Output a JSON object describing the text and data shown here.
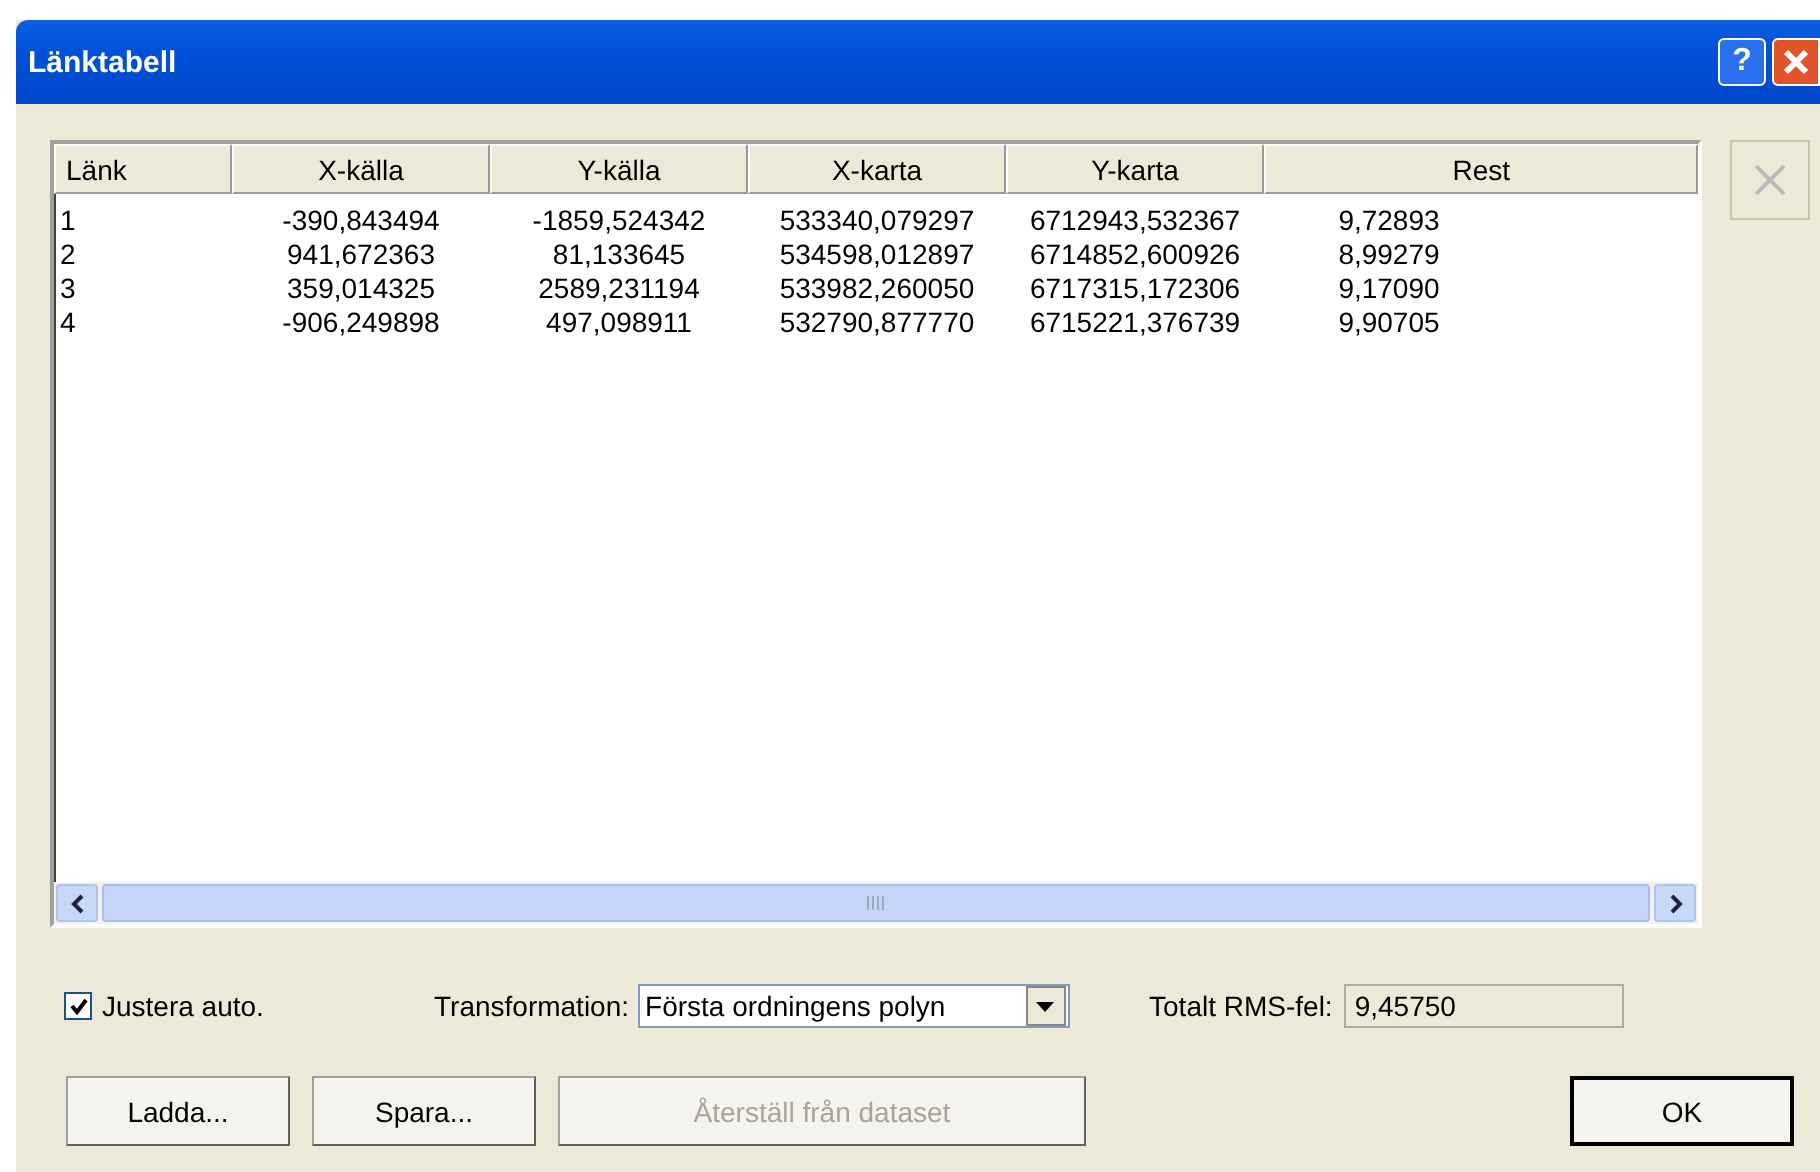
{
  "window": {
    "title": "Länktabell",
    "help_button": "?"
  },
  "table": {
    "columns": [
      "Länk",
      "X-källa",
      "Y-källa",
      "X-karta",
      "Y-karta",
      "Rest"
    ],
    "rows": [
      [
        "1",
        "-390,843494",
        "-1859,524342",
        "533340,079297",
        "6712943,532367",
        "9,72893"
      ],
      [
        "2",
        "941,672363",
        "81,133645",
        "534598,012897",
        "6714852,600926",
        "8,99279"
      ],
      [
        "3",
        "359,014325",
        "2589,231194",
        "533982,260050",
        "6717315,172306",
        "9,17090"
      ],
      [
        "4",
        "-906,249898",
        "497,098911",
        "532790,877770",
        "6715221,376739",
        "9,90705"
      ]
    ]
  },
  "delete_button": {
    "disabled": true
  },
  "auto_adjust": {
    "label": "Justera auto.",
    "checked": true
  },
  "transformation": {
    "label": "Transformation:",
    "value": "Första ordningens polyn"
  },
  "rms": {
    "label": "Totalt RMS-fel:",
    "value": "9,45750"
  },
  "buttons": [
    {
      "label": "Ladda...",
      "disabled": false
    },
    {
      "label": "Spara...",
      "disabled": false
    },
    {
      "label": "Återställ från dataset",
      "disabled": true
    },
    {
      "label": "OK",
      "disabled": false,
      "default": true
    }
  ]
}
